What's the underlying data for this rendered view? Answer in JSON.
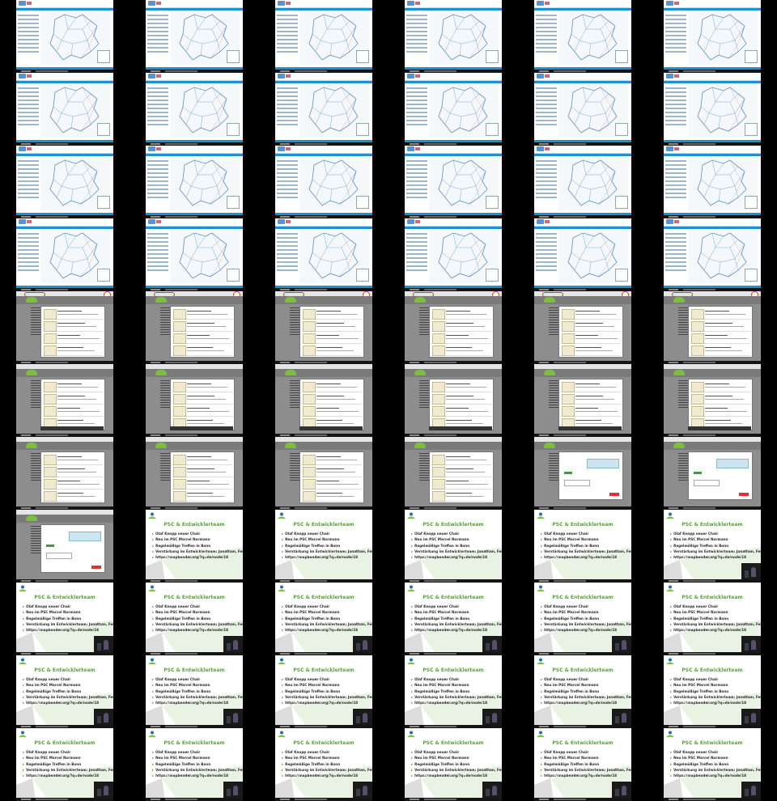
{
  "layout": {
    "columns": 6,
    "rows": 11
  },
  "colors": {
    "map_accent": "#1e8fd0",
    "meta_background": "#8d8d8d",
    "logo_green": "#7cbf3c",
    "slide_green": "#5aa630",
    "highlight_red": "#dd3333"
  },
  "slide": {
    "title": "PSC & Entwicklerteam",
    "bullets": [
      "Olaf Knopp neuer Chair",
      "Neu im PSC Marcel Normann",
      "Regelmäßige Treffen in Bonn",
      "Verstärkung im Entwicklerteam: Jonathan, Felix, Paolo",
      "https://mapbender.org/?q=de/node/18"
    ]
  },
  "frames": [
    "map",
    "map",
    "map",
    "map",
    "map",
    "map",
    "map",
    "map",
    "map",
    "map",
    "map",
    "map",
    "map",
    "map",
    "map",
    "map",
    "map",
    "map",
    "map",
    "map",
    "map",
    "map",
    "map",
    "map",
    "meta-circled",
    "meta-circled",
    "meta-circled",
    "meta-circled",
    "meta-circled",
    "meta-circled",
    "meta",
    "meta",
    "meta",
    "meta",
    "meta",
    "meta",
    "meta",
    "meta",
    "meta",
    "meta",
    "meta-form",
    "meta-form",
    "meta-form",
    "slide",
    "slide",
    "slide",
    "slide",
    "slide-cam",
    "slide-cam",
    "slide-cam",
    "slide-cam",
    "slide-cam",
    "slide-cam",
    "slide-cam",
    "slide-cam",
    "slide-cam",
    "slide-cam",
    "slide-cam",
    "slide-cam",
    "slide-cam",
    "slide-cam",
    "slide-cam",
    "slide-cam",
    "slide-cam",
    "slide-cam",
    "slide-cam"
  ]
}
